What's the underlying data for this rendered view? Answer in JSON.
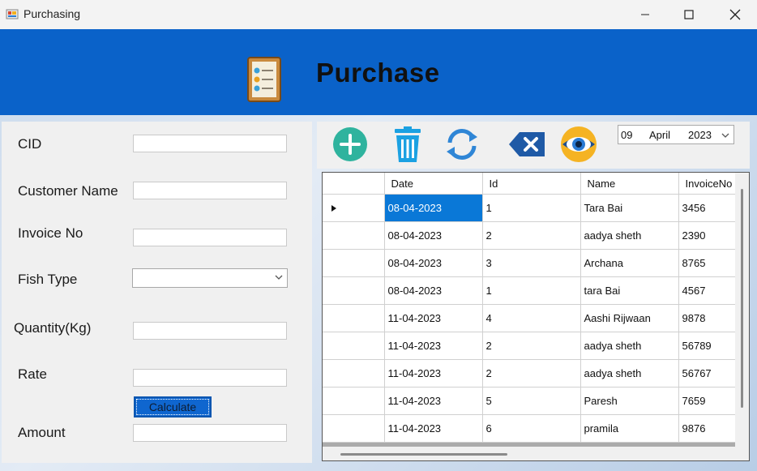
{
  "window": {
    "title": "Purchasing",
    "minimize": "—",
    "maximize": "☐",
    "close": "✕"
  },
  "header": {
    "title": "Purchase",
    "icon": "invoice-clipboard-icon"
  },
  "form": {
    "cid_label": "CID",
    "customer_name_label": "Customer Name",
    "invoice_no_label": "Invoice No",
    "fish_type_label": "Fish Type",
    "quantity_label": "Quantity(Kg)",
    "rate_label": "Rate",
    "calculate_label": "Calculate",
    "amount_label": "Amount",
    "cid_value": "",
    "customer_name_value": "",
    "invoice_no_value": "",
    "fish_type_value": "",
    "quantity_value": "",
    "rate_value": "",
    "amount_value": ""
  },
  "toolbar": {
    "icons": [
      "add-icon",
      "delete-trash-icon",
      "refresh-icon",
      "clear-backspace-icon",
      "view-eye-icon"
    ]
  },
  "date_picker": {
    "day": "09",
    "month": "April",
    "year": "2023"
  },
  "colors": {
    "header_blue": "#0a62c9",
    "add_green": "#2fb39e",
    "trash_blue": "#1ba1e2",
    "selection_blue": "#0a78d7"
  },
  "grid": {
    "columns": [
      "Date",
      "Id",
      "Name",
      "InvoiceNo"
    ],
    "rows": [
      [
        "08-04-2023",
        "1",
        "Tara Bai",
        "3456"
      ],
      [
        "08-04-2023",
        "2",
        "aadya sheth",
        "2390"
      ],
      [
        "08-04-2023",
        "3",
        "Archana",
        "8765"
      ],
      [
        "08-04-2023",
        "1",
        "tara Bai",
        "4567"
      ],
      [
        "11-04-2023",
        "4",
        "Aashi Rijwaan",
        "9878"
      ],
      [
        "11-04-2023",
        "2",
        "aadya sheth",
        "56789"
      ],
      [
        "11-04-2023",
        "2",
        "aadya sheth",
        "56767"
      ],
      [
        "11-04-2023",
        "5",
        "Paresh",
        "7659"
      ],
      [
        "11-04-2023",
        "6",
        "pramila",
        "9876"
      ]
    ]
  }
}
